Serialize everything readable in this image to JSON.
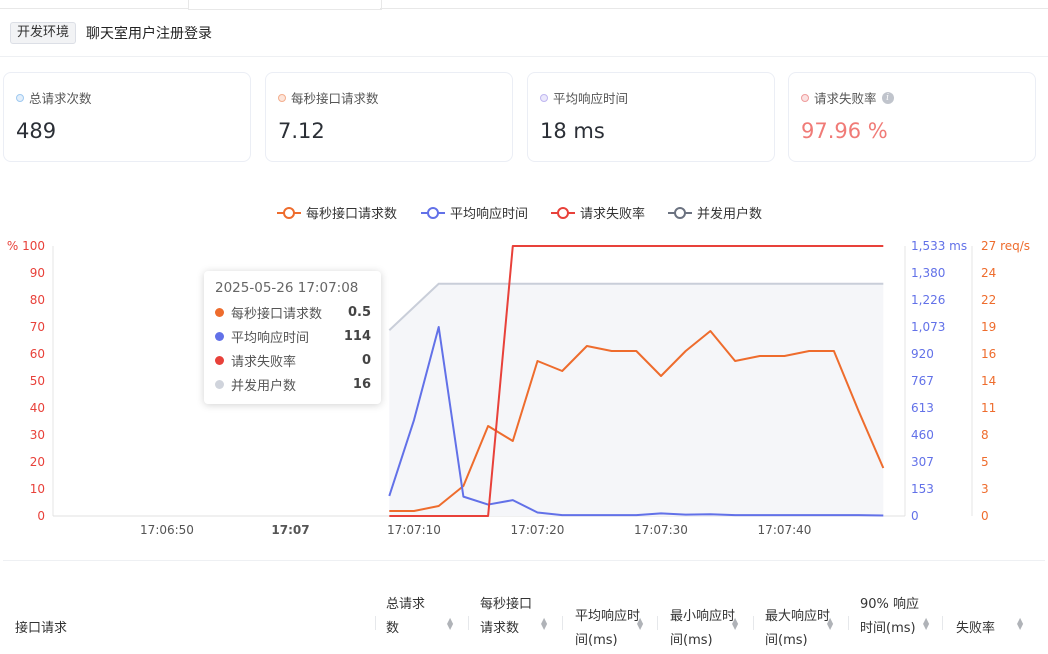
{
  "header": {
    "env_tag": "开发环境",
    "title": "聊天室用户注册登录"
  },
  "cards": [
    {
      "label": "总请求次数",
      "value": "489",
      "dot_color": "#b9d7f3",
      "value_color": "#2b2f36"
    },
    {
      "label": "每秒接口请求数",
      "value": "7.12",
      "dot_color": "#f6c4ab",
      "value_color": "#2b2f36"
    },
    {
      "label": "平均响应时间",
      "value": "18 ms",
      "dot_color": "#d3cdf5",
      "value_color": "#2b2f36"
    },
    {
      "label": "请求失败率",
      "value": "97.96 %",
      "dot_color": "#f3b8b8",
      "value_color": "#f07b77",
      "has_info_icon": true,
      "info_icon": "info-icon"
    }
  ],
  "chart_data": {
    "type": "line",
    "legend": [
      "每秒接口请求数",
      "平均响应时间",
      "请求失败率",
      "并发用户数"
    ],
    "colors": {
      "rps": "#ee6c2d",
      "resp": "#6271e8",
      "fail": "#e8413a",
      "users": "#c9ced9"
    },
    "x_ticks": [
      "17:06:50",
      "17:07",
      "17:07:10",
      "17:07:20",
      "17:07:30",
      "17:07:40"
    ],
    "x_tick_times": [
      "17:06:50",
      "17:07:00",
      "17:07:10",
      "17:07:20",
      "17:07:30",
      "17:07:40"
    ],
    "x": [
      "17:07:08",
      "17:07:10",
      "17:07:12",
      "17:07:14",
      "17:07:16",
      "17:07:18",
      "17:07:20",
      "17:07:22",
      "17:07:24",
      "17:07:26",
      "17:07:28",
      "17:07:30",
      "17:07:32",
      "17:07:34",
      "17:07:36",
      "17:07:38",
      "17:07:40",
      "17:07:42",
      "17:07:44",
      "17:07:46",
      "17:07:48"
    ],
    "left_axis": {
      "label": "%",
      "ticks": [
        "100",
        "90",
        "80",
        "70",
        "60",
        "50",
        "40",
        "30",
        "20",
        "10",
        "0"
      ],
      "max": 100
    },
    "right_axis_ms": {
      "unit": "ms",
      "ticks": [
        "1,533 ms",
        "1,380",
        "1,226",
        "1,073",
        "920",
        "767",
        "613",
        "460",
        "307",
        "153",
        "0"
      ],
      "max": 1533
    },
    "right_axis_rps": {
      "unit": "req/s",
      "ticks": [
        "27 req/s",
        "24",
        "22",
        "19",
        "16",
        "14",
        "11",
        "8",
        "5",
        "3",
        "0"
      ],
      "max": 27
    },
    "series": [
      {
        "name": "每秒接口请求数",
        "axis": "rps",
        "values": [
          0.5,
          0.5,
          1,
          3,
          9,
          7.5,
          15.5,
          14.5,
          17,
          16.5,
          16.5,
          14,
          16.5,
          18.5,
          15.5,
          16,
          16,
          16.5,
          16.5,
          10.5,
          4.8
        ]
      },
      {
        "name": "平均响应时间",
        "axis": "ms",
        "values": [
          114,
          545,
          1073,
          110,
          65,
          90,
          20,
          5,
          5,
          5,
          5,
          15,
          8,
          10,
          5,
          5,
          5,
          5,
          5,
          5,
          3
        ]
      },
      {
        "name": "请求失败率",
        "axis": "pct",
        "values": [
          0,
          0,
          0,
          0,
          0,
          100,
          100,
          100,
          100,
          100,
          100,
          100,
          100,
          100,
          100,
          100,
          100,
          100,
          100,
          100,
          100
        ]
      },
      {
        "name": "并发用户数",
        "axis": "users",
        "values": [
          16,
          18,
          20,
          20,
          20,
          20,
          20,
          20,
          20,
          20,
          20,
          20,
          20,
          20,
          20,
          20,
          20,
          20,
          20,
          20,
          20
        ]
      }
    ]
  },
  "tooltip": {
    "time": "2025-05-26 17:07:08",
    "rows": [
      {
        "name": "每秒接口请求数",
        "value": "0.5",
        "color": "#ee6c2d"
      },
      {
        "name": "平均响应时间",
        "value": "114",
        "color": "#6271e8"
      },
      {
        "name": "请求失败率",
        "value": "0",
        "color": "#e8413a"
      },
      {
        "name": "并发用户数",
        "value": "16",
        "color": "#d0d4dc"
      }
    ]
  },
  "table": {
    "headers": [
      {
        "label": "接口请求",
        "sortable": false
      },
      {
        "label": "总请求数",
        "sortable": true
      },
      {
        "label": "每秒接口请求数",
        "sortable": true
      },
      {
        "label": "平均响应时间(ms)",
        "sortable": true
      },
      {
        "label": "最小响应时间(ms)",
        "sortable": true
      },
      {
        "label": "最大响应时间(ms)",
        "sortable": true
      },
      {
        "label": "90% 响应时间(ms)",
        "sortable": true
      },
      {
        "label": "失败率",
        "sortable": true
      }
    ]
  }
}
